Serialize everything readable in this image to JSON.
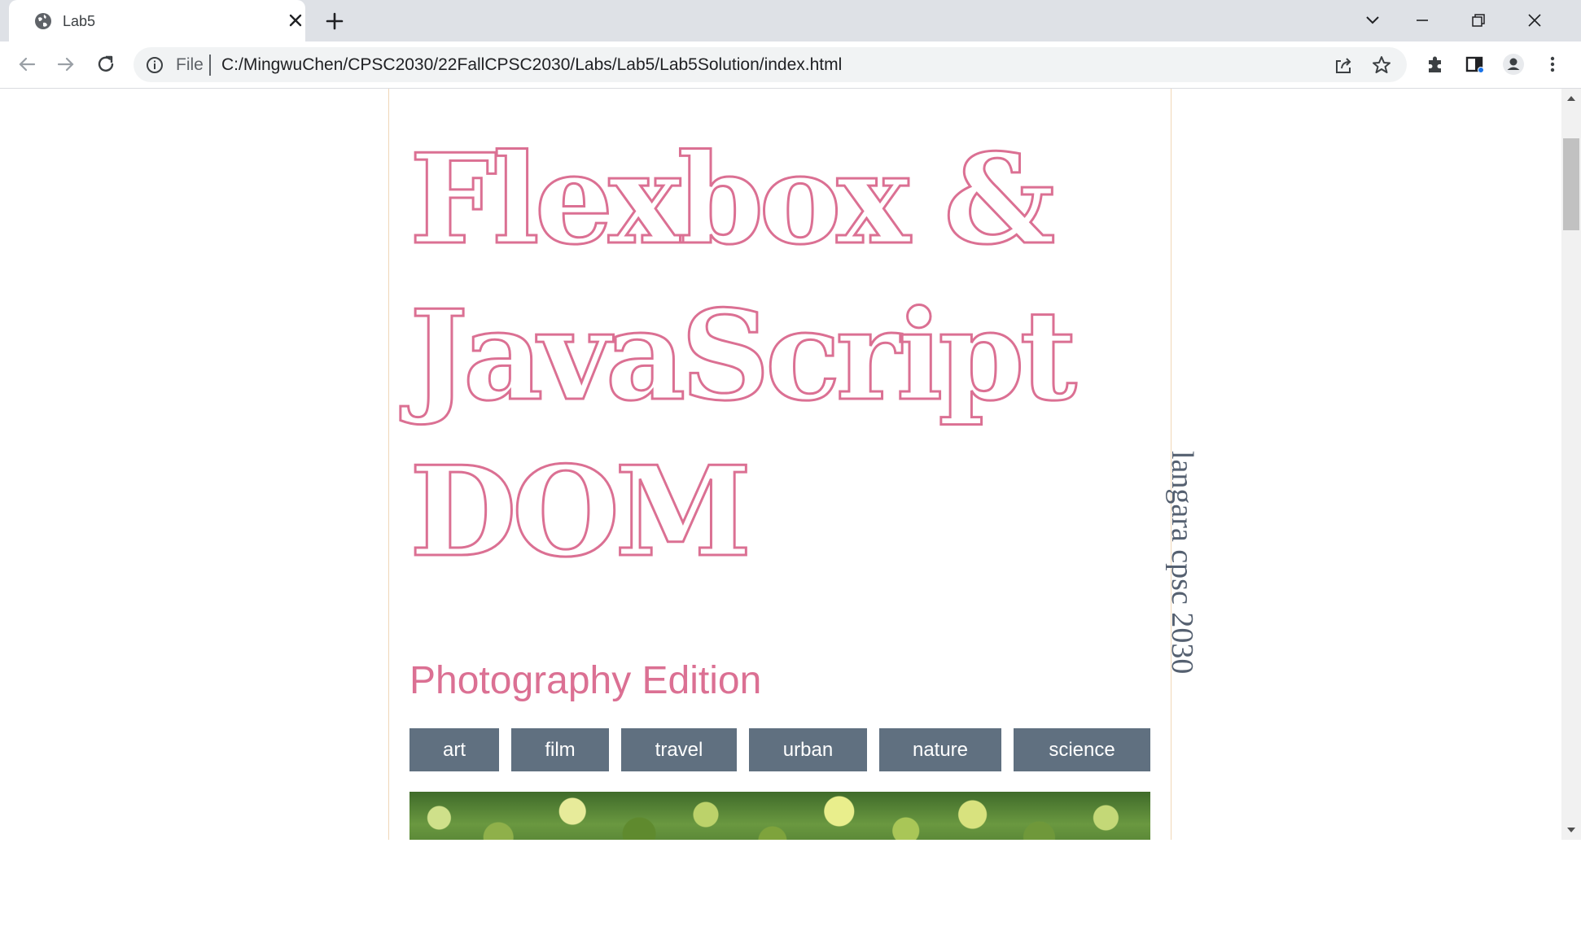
{
  "browser": {
    "tab_title": "Lab5",
    "address": {
      "scheme_label": "File",
      "url": "C:/MingwuChen/CPSC2030/22FallCPSC2030/Labs/Lab5/Lab5Solution/index.html"
    }
  },
  "page": {
    "title_lines": [
      "Flexbox &",
      "JavaScript",
      "DOM"
    ],
    "subtitle": "Photography Edition",
    "side_label": "langara cpsc 2030",
    "categories": [
      "art",
      "film",
      "travel",
      "urban",
      "nature",
      "science"
    ],
    "accent_color": "#db7093",
    "button_color": "#607080"
  }
}
